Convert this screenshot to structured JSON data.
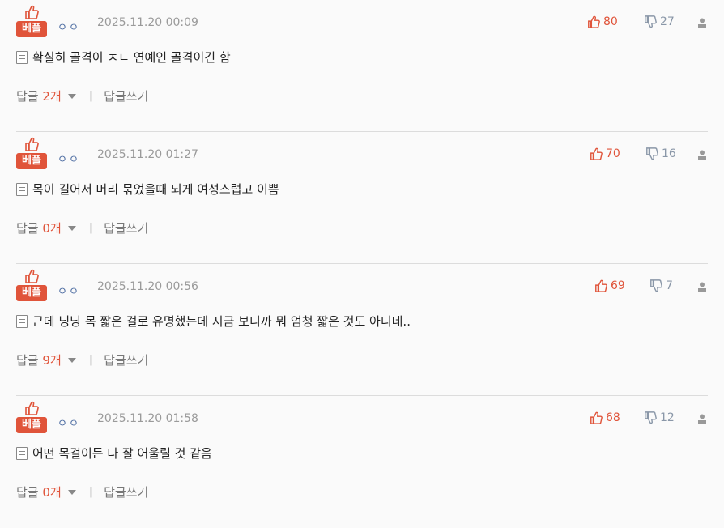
{
  "comments": [
    {
      "badge": "베플",
      "nick": "ㅇㅇ",
      "date": "2025.11.20 00:09",
      "likes": "80",
      "dislikes": "27",
      "text": "확실히 골격이 ㅈㄴ 연예인 골격이긴 함",
      "reply_label": "답글",
      "reply_count": "2개",
      "write_label": "답글쓰기"
    },
    {
      "badge": "베플",
      "nick": "ㅇㅇ",
      "date": "2025.11.20 01:27",
      "likes": "70",
      "dislikes": "16",
      "text": "목이 길어서 머리 묶었을때 되게 여성스럽고 이쁨",
      "reply_label": "답글",
      "reply_count": "0개",
      "write_label": "답글쓰기"
    },
    {
      "badge": "베플",
      "nick": "ㅇㅇ",
      "date": "2025.11.20 00:56",
      "likes": "69",
      "dislikes": "7",
      "text": "근데 닝닝 목 짧은 걸로 유명했는데 지금 보니까 뭐 엄청 짧은 것도 아니네..",
      "reply_label": "답글",
      "reply_count": "9개",
      "write_label": "답글쓰기"
    },
    {
      "badge": "베플",
      "nick": "ㅇㅇ",
      "date": "2025.11.20 01:58",
      "likes": "68",
      "dislikes": "12",
      "text": "어떤 목걸이든 다 잘 어울릴 것 같음",
      "reply_label": "답글",
      "reply_count": "0개",
      "write_label": "답글쓰기"
    }
  ],
  "colors": {
    "accent": "#e0543a",
    "nick": "#4a6aa0",
    "muted": "#9a9a9a"
  },
  "icons": {
    "badge": "thumbs-up-icon",
    "like": "thumbs-up-icon",
    "dislike": "thumbs-down-icon",
    "report": "report-user-icon",
    "body": "document-icon",
    "toggle": "caret-down-icon"
  }
}
